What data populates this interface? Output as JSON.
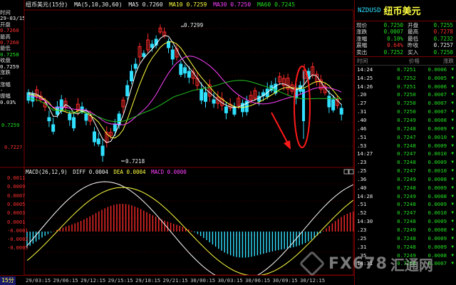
{
  "main_legend": {
    "symbol": "纽币美元(15分)",
    "ma_params": "MA(5,10,30,60)",
    "ma5": "MA5 0.7260",
    "ma10": "MA10 0.7259",
    "ma30": "MA30 0.7250",
    "ma60": "MA60 0.7245"
  },
  "left_panel": {
    "time_label": "时间",
    "date": "29-03/15",
    "open_label": "开盘",
    "open": "0.7260",
    "high_label": "最高",
    "high": "0.7260",
    "low_label": "最低",
    "low": "0.7258",
    "close_label": "收盘",
    "close": "0.7259",
    "chg_label": "涨跌",
    "chg": "-",
    "amp_label": "涨幅",
    "amp": "-",
    "range_label": "振幅",
    "range": "0.03%"
  },
  "price_axis": {
    "a": "0.7259",
    "b": "0.7227"
  },
  "annotations": {
    "high_marker": "0.7299",
    "low_marker": "0.7218"
  },
  "macd_legend": {
    "params": "MACD(26,12,9)",
    "diff": "DIFF 0.0004",
    "dea": "DEA 0.0004",
    "macd": "MACD 0.0000"
  },
  "macd_axis": [
    "0.0011",
    "0.0009",
    "0.0007",
    "0.0005",
    "0.0003",
    "0.0001",
    "-0.0001",
    "-0.0003",
    "-0.0005"
  ],
  "time_axis": {
    "period": "15分",
    "ticks": [
      "29/03:15",
      "29/06:15",
      "29/12:15",
      "29/15:15",
      "29/18:15",
      "29/21:15",
      "30/00:15",
      "30/03:15",
      "30/06:15",
      "30/09:15",
      "30/12:15"
    ]
  },
  "quote": {
    "code": "NZDUSD",
    "name": "纽币美元",
    "rows": [
      {
        "k": "现价",
        "v": "0.7250",
        "vc": "green",
        "k2": "开盘",
        "v2": "0.7255",
        "v2c": "green"
      },
      {
        "k": "涨跌",
        "v": "0.0007",
        "vc": "green",
        "k2": "最高",
        "v2": "0.7278",
        "v2c": "red"
      },
      {
        "k": "涨幅",
        "v": "0.10%",
        "vc": "green",
        "k2": "最低",
        "v2": "0.7232",
        "v2c": "green"
      },
      {
        "k": "震幅",
        "v": "0.64%",
        "vc": "red",
        "k2": "昨收",
        "v2": "0.7257",
        "v2c": "white"
      },
      {
        "k": "卖出",
        "v": "0.7252",
        "vc": "green",
        "k2": "买入",
        "v2": "0.7250",
        "v2c": "green"
      }
    ]
  },
  "ticks_header": {
    "time": "时间",
    "price": "价格",
    "change": "涨跌"
  },
  "ticks": [
    {
      "t": "14:24",
      "p": "0.7251",
      "c": "0.0006"
    },
    {
      "t": "14:25",
      "p": "0.7252",
      "c": "0.0005"
    },
    {
      "t": "14:26",
      "p": "0.7251",
      "c": "0.0006"
    },
    {
      "t": ".20",
      "p": "0.7250",
      "c": "0.0007"
    },
    {
      "t": ".27",
      "p": "0.7250",
      "c": "0.0007"
    },
    {
      "t": ".31",
      "p": "0.7250",
      "c": "0.0007"
    },
    {
      "t": ".40",
      "p": "0.7249",
      "c": "0.0008"
    },
    {
      "t": ".46",
      "p": "0.7248",
      "c": "0.0009"
    },
    {
      "t": ".51",
      "p": "0.7247",
      "c": "0.0010"
    },
    {
      "t": ".53",
      "p": "0.7248",
      "c": "0.0009"
    },
    {
      "t": "14:27",
      "p": "0.7247",
      "c": "0.0010"
    },
    {
      "t": ".23",
      "p": "0.7248",
      "c": "0.0009"
    },
    {
      "t": ".25",
      "p": "0.7247",
      "c": "0.0010"
    },
    {
      "t": ".36",
      "p": "0.7249",
      "c": "0.0008"
    },
    {
      "t": ".40",
      "p": "0.7248",
      "c": "0.0009"
    },
    {
      "t": "14:28",
      "p": "0.7249",
      "c": "0.0008"
    },
    {
      "t": ".51",
      "p": "0.7248",
      "c": "0.0009"
    },
    {
      "t": ".52",
      "p": "0.7247",
      "c": "0.0010"
    },
    {
      "t": "14:30",
      "p": "0.7248",
      "c": "0.0009"
    },
    {
      "t": ".23",
      "p": "0.7249",
      "c": "0.0008"
    },
    {
      "t": ".25",
      "p": "0.7248",
      "c": "0.0009"
    },
    {
      "t": ".31",
      "p": "0.7248",
      "c": "0.0009"
    },
    {
      "t": ".35",
      "p": "0.7249",
      "c": "0.0008"
    },
    {
      "t": "14:31",
      "p": "0.7250",
      "c": "0.0007"
    }
  ],
  "watermark": {
    "brand": "FX678",
    "cn": "汇通网"
  }
}
